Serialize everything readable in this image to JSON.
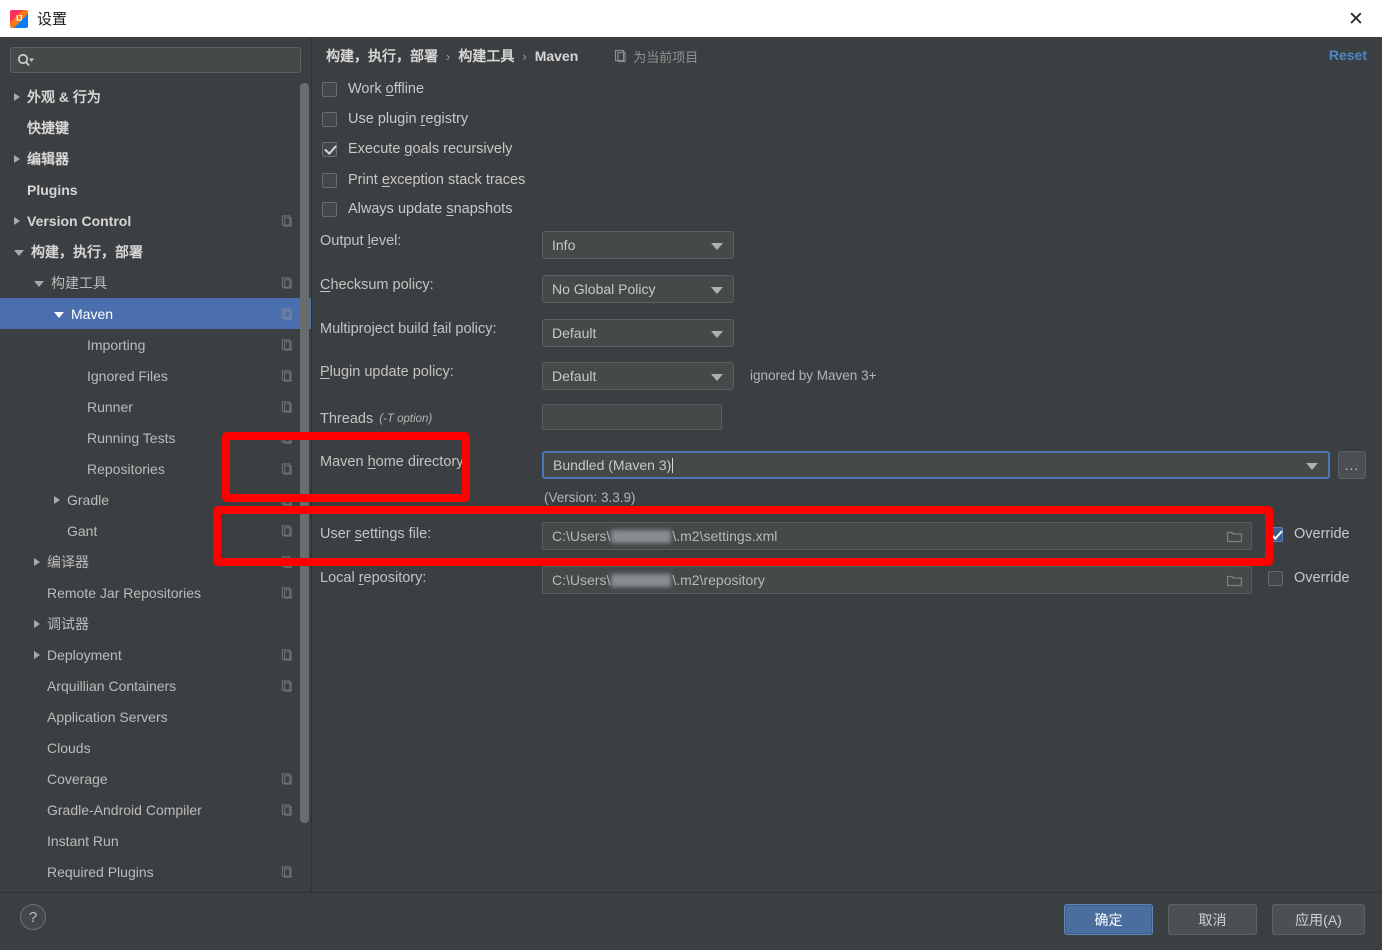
{
  "window": {
    "title": "设置",
    "app_icon": "intellij-idea-icon",
    "close_label": "✕"
  },
  "sidebar": {
    "search": {
      "placeholder": "",
      "value": "",
      "icon": "search-icon"
    },
    "items": [
      {
        "label": "外观 & 行为",
        "indent": 0,
        "arrow": "closed",
        "bold": true,
        "badge": false,
        "selected": false
      },
      {
        "label": "快捷键",
        "indent": 0,
        "arrow": "none",
        "bold": true,
        "badge": false,
        "selected": false
      },
      {
        "label": "编辑器",
        "indent": 0,
        "arrow": "closed",
        "bold": true,
        "badge": false,
        "selected": false
      },
      {
        "label": "Plugins",
        "indent": 0,
        "arrow": "none",
        "bold": true,
        "badge": false,
        "selected": false
      },
      {
        "label": "Version Control",
        "indent": 0,
        "arrow": "closed",
        "bold": true,
        "badge": true,
        "selected": false
      },
      {
        "label": "构建，执行，部署",
        "indent": 0,
        "arrow": "open",
        "bold": true,
        "badge": false,
        "selected": false
      },
      {
        "label": "构建工具",
        "indent": 1,
        "arrow": "open",
        "bold": false,
        "badge": true,
        "selected": false
      },
      {
        "label": "Maven",
        "indent": 2,
        "arrow": "open",
        "bold": false,
        "badge": true,
        "selected": true
      },
      {
        "label": "Importing",
        "indent": 3,
        "arrow": "none",
        "bold": false,
        "badge": true,
        "selected": false
      },
      {
        "label": "Ignored Files",
        "indent": 3,
        "arrow": "none",
        "bold": false,
        "badge": true,
        "selected": false
      },
      {
        "label": "Runner",
        "indent": 3,
        "arrow": "none",
        "bold": false,
        "badge": true,
        "selected": false
      },
      {
        "label": "Running Tests",
        "indent": 3,
        "arrow": "none",
        "bold": false,
        "badge": true,
        "selected": false
      },
      {
        "label": "Repositories",
        "indent": 3,
        "arrow": "none",
        "bold": false,
        "badge": true,
        "selected": false
      },
      {
        "label": "Gradle",
        "indent": 2,
        "arrow": "closed",
        "bold": false,
        "badge": true,
        "selected": false
      },
      {
        "label": "Gant",
        "indent": 2,
        "arrow": "none",
        "bold": false,
        "badge": true,
        "selected": false
      },
      {
        "label": "编译器",
        "indent": 1,
        "arrow": "closed",
        "bold": false,
        "badge": true,
        "selected": false
      },
      {
        "label": "Remote Jar Repositories",
        "indent": 1,
        "arrow": "none",
        "bold": false,
        "badge": true,
        "selected": false
      },
      {
        "label": "调试器",
        "indent": 1,
        "arrow": "closed",
        "bold": false,
        "badge": false,
        "selected": false
      },
      {
        "label": "Deployment",
        "indent": 1,
        "arrow": "closed",
        "bold": false,
        "badge": true,
        "selected": false
      },
      {
        "label": "Arquillian Containers",
        "indent": 1,
        "arrow": "none",
        "bold": false,
        "badge": true,
        "selected": false
      },
      {
        "label": "Application Servers",
        "indent": 1,
        "arrow": "none",
        "bold": false,
        "badge": false,
        "selected": false
      },
      {
        "label": "Clouds",
        "indent": 1,
        "arrow": "none",
        "bold": false,
        "badge": false,
        "selected": false
      },
      {
        "label": "Coverage",
        "indent": 1,
        "arrow": "none",
        "bold": false,
        "badge": true,
        "selected": false
      },
      {
        "label": "Gradle-Android Compiler",
        "indent": 1,
        "arrow": "none",
        "bold": false,
        "badge": true,
        "selected": false
      },
      {
        "label": "Instant Run",
        "indent": 1,
        "arrow": "none",
        "bold": false,
        "badge": false,
        "selected": false
      },
      {
        "label": "Required Plugins",
        "indent": 1,
        "arrow": "none",
        "bold": false,
        "badge": true,
        "selected": false
      }
    ]
  },
  "header": {
    "crumb1": "构建，执行，部署",
    "crumb2": "构建工具",
    "crumb3": "Maven",
    "scope_label": "为当前项目",
    "scope_icon": "project-scope-icon",
    "reset_label": "Reset"
  },
  "options": {
    "checkboxes": [
      {
        "pre": "Work ",
        "mn": "o",
        "post": "ffline",
        "checked": false
      },
      {
        "pre": "Use plugin ",
        "mn": "r",
        "post": "egistry",
        "checked": false
      },
      {
        "pre": "Execute ",
        "mn": "g",
        "post": "oals recursively",
        "checked": true
      },
      {
        "pre": "Print ",
        "mn": "e",
        "post": "xception stack traces",
        "checked": false
      },
      {
        "pre": "Always update ",
        "mn": "s",
        "post": "napshots",
        "checked": false
      }
    ]
  },
  "fields": {
    "output_level": {
      "pre": "Output ",
      "mn": "l",
      "post": "evel:",
      "value": "Info"
    },
    "checksum_policy": {
      "pre": "",
      "mn": "C",
      "post": "hecksum policy:",
      "value": "No Global Policy"
    },
    "multiproject_fail": {
      "pre": "Multiproject build ",
      "mn": "f",
      "post": "ail policy:",
      "value": "Default"
    },
    "plugin_update": {
      "pre": "",
      "mn": "P",
      "post": "lugin update policy:",
      "value": "Default",
      "note": "ignored by Maven 3+"
    },
    "threads": {
      "label": "Threads",
      "hint": "(-T option)",
      "value": ""
    },
    "maven_home": {
      "pre": "Maven ",
      "mn": "h",
      "post": "ome directory:",
      "value": "Bundled (Maven 3)",
      "version_note": "(Version: 3.3.9)",
      "browse_label": "..."
    },
    "user_settings": {
      "pre": "User ",
      "mn": "s",
      "post": "ettings file:",
      "value_prefix": "C:\\Users\\",
      "value_suffix": "\\.m2\\settings.xml",
      "override_label": "Override",
      "override_checked": true
    },
    "local_repository": {
      "pre": "Local ",
      "mn": "r",
      "post": "epository:",
      "value_prefix": "C:\\Users\\",
      "value_suffix": "\\.m2\\repository",
      "override_label": "Override",
      "override_checked": false
    }
  },
  "footer": {
    "help_label": "?",
    "ok_label": "确定",
    "cancel_label": "取消",
    "apply_label": "应用(A)"
  },
  "colors": {
    "accent_blue": "#4b6eaf",
    "link_blue": "#4a88c7",
    "annotation_red": "#fe0000",
    "panel_bg": "#3c3f41"
  }
}
